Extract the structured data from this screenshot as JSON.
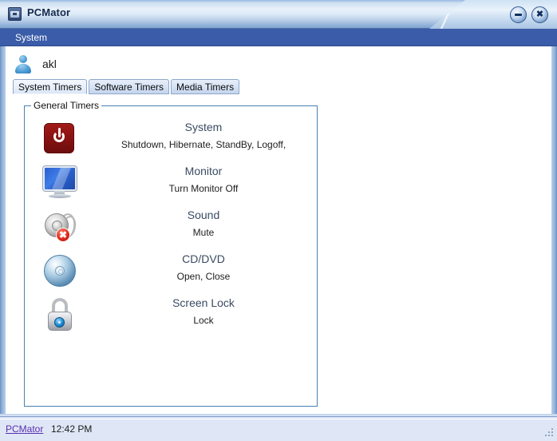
{
  "window": {
    "title": "PCMator",
    "icon": "app-icon",
    "minimize_label": "–",
    "close_label": "✖"
  },
  "menubar": {
    "items": [
      {
        "label": "System"
      }
    ]
  },
  "user": {
    "name": "akl",
    "avatar_icon": "user-avatar-icon"
  },
  "tabs": [
    {
      "label": "System Timers",
      "active": true
    },
    {
      "label": "Software Timers",
      "active": false
    },
    {
      "label": "Media Timers",
      "active": false
    }
  ],
  "groupbox": {
    "legend": "General Timers",
    "rows": [
      {
        "icon": "power-icon",
        "title": "System",
        "subtitle": "Shutdown, Hibernate, StandBy, Logoff,"
      },
      {
        "icon": "monitor-icon",
        "title": "Monitor",
        "subtitle": "Turn Monitor Off"
      },
      {
        "icon": "speaker-mute-icon",
        "title": "Sound",
        "subtitle": "Mute"
      },
      {
        "icon": "disc-icon",
        "title": "CD/DVD",
        "subtitle": "Open, Close"
      },
      {
        "icon": "lock-icon",
        "title": "Screen Lock",
        "subtitle": "Lock"
      }
    ]
  },
  "statusbar": {
    "link_label": "PCMator",
    "time": "12:42 PM",
    "grip_icon": "resize-grip-icon"
  },
  "colors": {
    "titlebar_blue": "#b9cfe8",
    "menubar_blue": "#3b5ca8",
    "group_border": "#4a7fb5",
    "heading_text": "#3a4b63",
    "link_purple": "#5b2fb0",
    "status_bg": "#dfe7f6",
    "power_red": "#8b1212",
    "monitor_blue": "#3f7ce6",
    "badge_red": "#e02b1d",
    "lock_blue": "#1d8ed6"
  }
}
